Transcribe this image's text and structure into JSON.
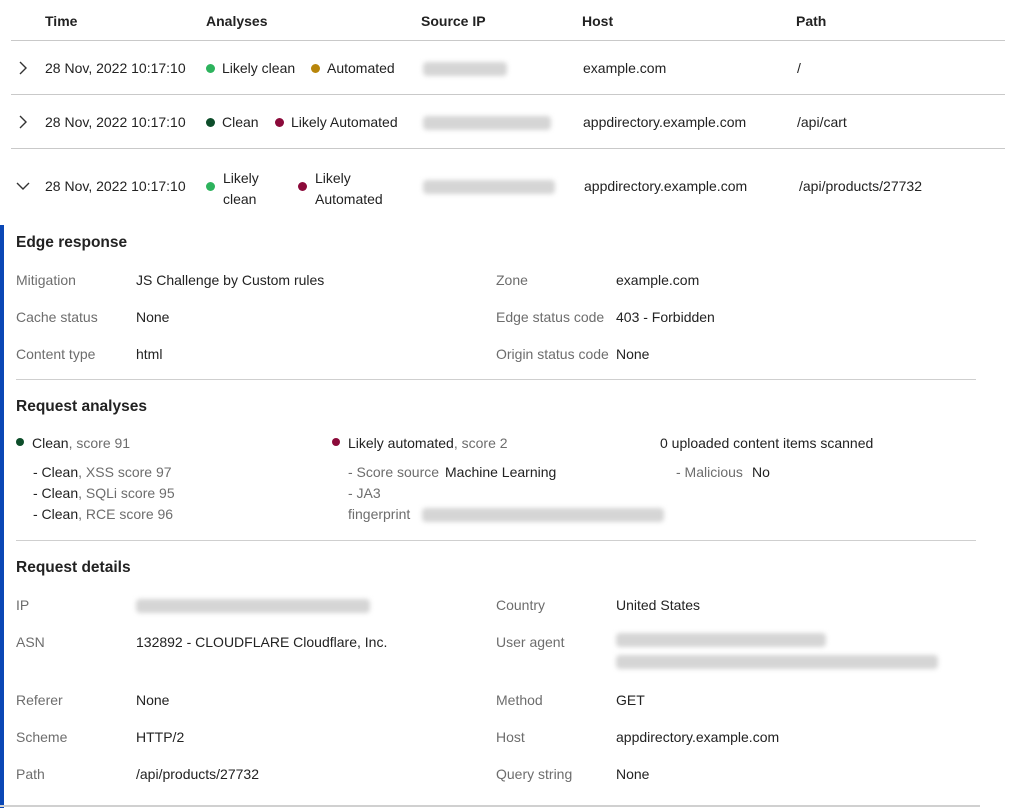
{
  "table": {
    "headers": [
      "Time",
      "Analyses",
      "Source IP",
      "Host",
      "Path"
    ],
    "rows": [
      {
        "time": "28 Nov, 2022 10:17:10",
        "a1": "Likely clean",
        "a2": "Automated",
        "host": "example.com",
        "path": "/"
      },
      {
        "time": "28 Nov, 2022 10:17:10",
        "a1": "Clean",
        "a2": "Likely Automated",
        "host": "appdirectory.example.com",
        "path": "/api/cart"
      },
      {
        "time": "28 Nov, 2022 10:17:10",
        "a1_l1": "Likely",
        "a1_l2": "clean",
        "a2_l1": "Likely",
        "a2_l2": "Automated",
        "host": "appdirectory.example.com",
        "path": "/api/products/27732"
      }
    ]
  },
  "colors": {
    "likely_clean": "#2db35d",
    "automated": "#b8860b",
    "clean": "#0d4d2a",
    "likely_automated": "#8b0a3a",
    "accent": "#0a47b5"
  },
  "edge": {
    "title": "Edge response",
    "mitigation_label": "Mitigation",
    "mitigation": "JS Challenge by Custom rules",
    "cache_label": "Cache status",
    "cache": "None",
    "ctype_label": "Content type",
    "ctype": "html",
    "zone_label": "Zone",
    "zone": "example.com",
    "edge_code_label": "Edge status code",
    "edge_code": "403 - Forbidden",
    "origin_code_label": "Origin status code",
    "origin_code": "None"
  },
  "analyses": {
    "title": "Request analyses",
    "clean_main": "Clean",
    "clean_score": ", score 91",
    "xss_pre": "- Clean",
    "xss": ", XSS score 97",
    "sqli_pre": "- Clean",
    "sqli": ", SQLi score 95",
    "rce_pre": "- Clean",
    "rce": ", RCE score 96",
    "auto_main": "Likely automated",
    "auto_score": ", score 2",
    "score_source_label": "- Score source",
    "score_source": "Machine Learning",
    "ja3_l1": "- JA3",
    "ja3_l2": "fingerprint",
    "uploaded": "0 uploaded content items scanned",
    "malicious_label": "- Malicious",
    "malicious": "No"
  },
  "details": {
    "title": "Request details",
    "ip_label": "IP",
    "asn_label": "ASN",
    "asn": "132892 - CLOUDFLARE Cloudflare, Inc.",
    "referer_label": "Referer",
    "referer": "None",
    "scheme_label": "Scheme",
    "scheme": "HTTP/2",
    "path_label": "Path",
    "path": "/api/products/27732",
    "country_label": "Country",
    "country": "United States",
    "ua_label": "User agent",
    "method_label": "Method",
    "method": "GET",
    "host_label": "Host",
    "host": "appdirectory.example.com",
    "query_label": "Query string",
    "query": "None"
  }
}
